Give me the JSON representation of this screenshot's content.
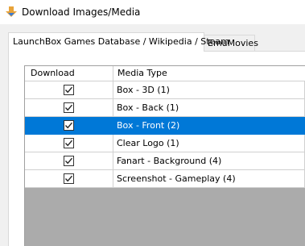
{
  "window": {
    "title": "Download Images/Media",
    "icon": "download-arrow-icon"
  },
  "tabs": [
    {
      "label": "LaunchBox Games Database / Wikipedia / Steam",
      "active": true
    },
    {
      "label": "EmuMovies",
      "active": false
    }
  ],
  "grid": {
    "columns": [
      "Download",
      "Media Type"
    ],
    "rows": [
      {
        "download": true,
        "media_type": "Box - 3D (1)",
        "selected": false
      },
      {
        "download": true,
        "media_type": "Box - Back (1)",
        "selected": false
      },
      {
        "download": true,
        "media_type": "Box - Front (2)",
        "selected": true
      },
      {
        "download": true,
        "media_type": "Clear Logo (1)",
        "selected": false
      },
      {
        "download": true,
        "media_type": "Fanart - Background (4)",
        "selected": false
      },
      {
        "download": true,
        "media_type": "Screenshot - Gameplay (4)",
        "selected": false
      }
    ]
  },
  "colors": {
    "selection": "#0078d7",
    "empty_grid_area": "#ababab",
    "icon_orange": "#e8a33a",
    "icon_blue": "#3a7bd5"
  }
}
